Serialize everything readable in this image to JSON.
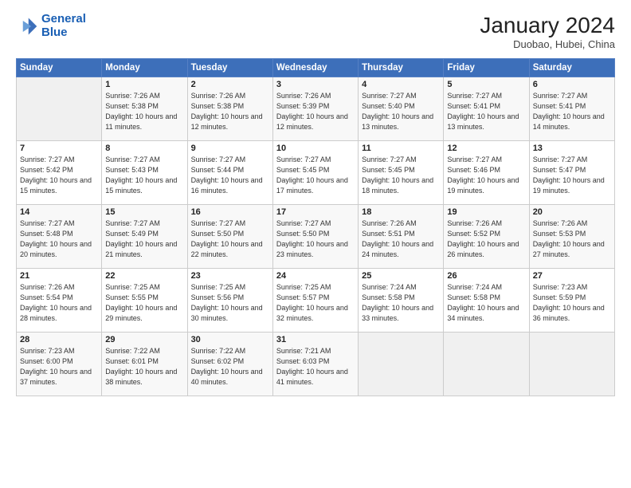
{
  "logo": {
    "line1": "General",
    "line2": "Blue"
  },
  "title": "January 2024",
  "location": "Duobao, Hubei, China",
  "days_of_week": [
    "Sunday",
    "Monday",
    "Tuesday",
    "Wednesday",
    "Thursday",
    "Friday",
    "Saturday"
  ],
  "weeks": [
    [
      {
        "day": "",
        "sunrise": "",
        "sunset": "",
        "daylight": ""
      },
      {
        "day": "1",
        "sunrise": "Sunrise: 7:26 AM",
        "sunset": "Sunset: 5:38 PM",
        "daylight": "Daylight: 10 hours and 11 minutes."
      },
      {
        "day": "2",
        "sunrise": "Sunrise: 7:26 AM",
        "sunset": "Sunset: 5:38 PM",
        "daylight": "Daylight: 10 hours and 12 minutes."
      },
      {
        "day": "3",
        "sunrise": "Sunrise: 7:26 AM",
        "sunset": "Sunset: 5:39 PM",
        "daylight": "Daylight: 10 hours and 12 minutes."
      },
      {
        "day": "4",
        "sunrise": "Sunrise: 7:27 AM",
        "sunset": "Sunset: 5:40 PM",
        "daylight": "Daylight: 10 hours and 13 minutes."
      },
      {
        "day": "5",
        "sunrise": "Sunrise: 7:27 AM",
        "sunset": "Sunset: 5:41 PM",
        "daylight": "Daylight: 10 hours and 13 minutes."
      },
      {
        "day": "6",
        "sunrise": "Sunrise: 7:27 AM",
        "sunset": "Sunset: 5:41 PM",
        "daylight": "Daylight: 10 hours and 14 minutes."
      }
    ],
    [
      {
        "day": "7",
        "sunrise": "Sunrise: 7:27 AM",
        "sunset": "Sunset: 5:42 PM",
        "daylight": "Daylight: 10 hours and 15 minutes."
      },
      {
        "day": "8",
        "sunrise": "Sunrise: 7:27 AM",
        "sunset": "Sunset: 5:43 PM",
        "daylight": "Daylight: 10 hours and 15 minutes."
      },
      {
        "day": "9",
        "sunrise": "Sunrise: 7:27 AM",
        "sunset": "Sunset: 5:44 PM",
        "daylight": "Daylight: 10 hours and 16 minutes."
      },
      {
        "day": "10",
        "sunrise": "Sunrise: 7:27 AM",
        "sunset": "Sunset: 5:45 PM",
        "daylight": "Daylight: 10 hours and 17 minutes."
      },
      {
        "day": "11",
        "sunrise": "Sunrise: 7:27 AM",
        "sunset": "Sunset: 5:45 PM",
        "daylight": "Daylight: 10 hours and 18 minutes."
      },
      {
        "day": "12",
        "sunrise": "Sunrise: 7:27 AM",
        "sunset": "Sunset: 5:46 PM",
        "daylight": "Daylight: 10 hours and 19 minutes."
      },
      {
        "day": "13",
        "sunrise": "Sunrise: 7:27 AM",
        "sunset": "Sunset: 5:47 PM",
        "daylight": "Daylight: 10 hours and 19 minutes."
      }
    ],
    [
      {
        "day": "14",
        "sunrise": "Sunrise: 7:27 AM",
        "sunset": "Sunset: 5:48 PM",
        "daylight": "Daylight: 10 hours and 20 minutes."
      },
      {
        "day": "15",
        "sunrise": "Sunrise: 7:27 AM",
        "sunset": "Sunset: 5:49 PM",
        "daylight": "Daylight: 10 hours and 21 minutes."
      },
      {
        "day": "16",
        "sunrise": "Sunrise: 7:27 AM",
        "sunset": "Sunset: 5:50 PM",
        "daylight": "Daylight: 10 hours and 22 minutes."
      },
      {
        "day": "17",
        "sunrise": "Sunrise: 7:27 AM",
        "sunset": "Sunset: 5:50 PM",
        "daylight": "Daylight: 10 hours and 23 minutes."
      },
      {
        "day": "18",
        "sunrise": "Sunrise: 7:26 AM",
        "sunset": "Sunset: 5:51 PM",
        "daylight": "Daylight: 10 hours and 24 minutes."
      },
      {
        "day": "19",
        "sunrise": "Sunrise: 7:26 AM",
        "sunset": "Sunset: 5:52 PM",
        "daylight": "Daylight: 10 hours and 26 minutes."
      },
      {
        "day": "20",
        "sunrise": "Sunrise: 7:26 AM",
        "sunset": "Sunset: 5:53 PM",
        "daylight": "Daylight: 10 hours and 27 minutes."
      }
    ],
    [
      {
        "day": "21",
        "sunrise": "Sunrise: 7:26 AM",
        "sunset": "Sunset: 5:54 PM",
        "daylight": "Daylight: 10 hours and 28 minutes."
      },
      {
        "day": "22",
        "sunrise": "Sunrise: 7:25 AM",
        "sunset": "Sunset: 5:55 PM",
        "daylight": "Daylight: 10 hours and 29 minutes."
      },
      {
        "day": "23",
        "sunrise": "Sunrise: 7:25 AM",
        "sunset": "Sunset: 5:56 PM",
        "daylight": "Daylight: 10 hours and 30 minutes."
      },
      {
        "day": "24",
        "sunrise": "Sunrise: 7:25 AM",
        "sunset": "Sunset: 5:57 PM",
        "daylight": "Daylight: 10 hours and 32 minutes."
      },
      {
        "day": "25",
        "sunrise": "Sunrise: 7:24 AM",
        "sunset": "Sunset: 5:58 PM",
        "daylight": "Daylight: 10 hours and 33 minutes."
      },
      {
        "day": "26",
        "sunrise": "Sunrise: 7:24 AM",
        "sunset": "Sunset: 5:58 PM",
        "daylight": "Daylight: 10 hours and 34 minutes."
      },
      {
        "day": "27",
        "sunrise": "Sunrise: 7:23 AM",
        "sunset": "Sunset: 5:59 PM",
        "daylight": "Daylight: 10 hours and 36 minutes."
      }
    ],
    [
      {
        "day": "28",
        "sunrise": "Sunrise: 7:23 AM",
        "sunset": "Sunset: 6:00 PM",
        "daylight": "Daylight: 10 hours and 37 minutes."
      },
      {
        "day": "29",
        "sunrise": "Sunrise: 7:22 AM",
        "sunset": "Sunset: 6:01 PM",
        "daylight": "Daylight: 10 hours and 38 minutes."
      },
      {
        "day": "30",
        "sunrise": "Sunrise: 7:22 AM",
        "sunset": "Sunset: 6:02 PM",
        "daylight": "Daylight: 10 hours and 40 minutes."
      },
      {
        "day": "31",
        "sunrise": "Sunrise: 7:21 AM",
        "sunset": "Sunset: 6:03 PM",
        "daylight": "Daylight: 10 hours and 41 minutes."
      },
      {
        "day": "",
        "sunrise": "",
        "sunset": "",
        "daylight": ""
      },
      {
        "day": "",
        "sunrise": "",
        "sunset": "",
        "daylight": ""
      },
      {
        "day": "",
        "sunrise": "",
        "sunset": "",
        "daylight": ""
      }
    ]
  ]
}
